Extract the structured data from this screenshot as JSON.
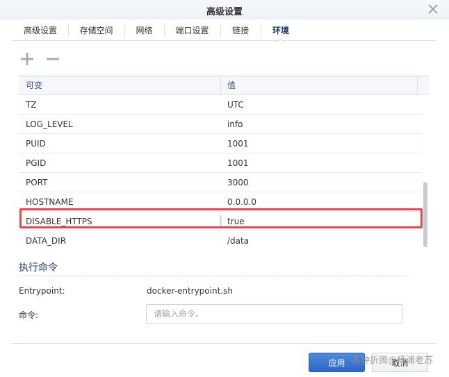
{
  "window": {
    "title": "高级设置"
  },
  "tabs": [
    {
      "label": "高级设置"
    },
    {
      "label": "存储空间"
    },
    {
      "label": "网络"
    },
    {
      "label": "端口设置"
    },
    {
      "label": "链接"
    },
    {
      "label": "环境"
    }
  ],
  "active_tab": "环境",
  "grid": {
    "columns": [
      {
        "label": "可变"
      },
      {
        "label": "值"
      }
    ],
    "rows": [
      {
        "key": "TZ",
        "value": "UTC"
      },
      {
        "key": "LOG_LEVEL",
        "value": "info"
      },
      {
        "key": "PUID",
        "value": "1001"
      },
      {
        "key": "PGID",
        "value": "1001"
      },
      {
        "key": "PORT",
        "value": "3000"
      },
      {
        "key": "HOSTNAME",
        "value": "0.0.0.0"
      },
      {
        "key": "DISABLE_HTTPS",
        "value": "true"
      },
      {
        "key": "DATA_DIR",
        "value": "/data"
      }
    ],
    "selected_row": "DISABLE_HTTPS"
  },
  "command_section": {
    "title": "执行命令",
    "entrypoint_label": "Entrypoint:",
    "entrypoint_value": "docker-entrypoint.sh",
    "command_label": "命令:",
    "command_placeholder": "请输入命令。",
    "command_value": ""
  },
  "footer": {
    "apply_label": "应用",
    "cancel_label": "取消"
  },
  "watermark": "各种折腾@杨浦老苏",
  "colors": {
    "accent": "#2c66c3",
    "highlight": "#e8474f",
    "title_blue": "#1c3a6b"
  }
}
